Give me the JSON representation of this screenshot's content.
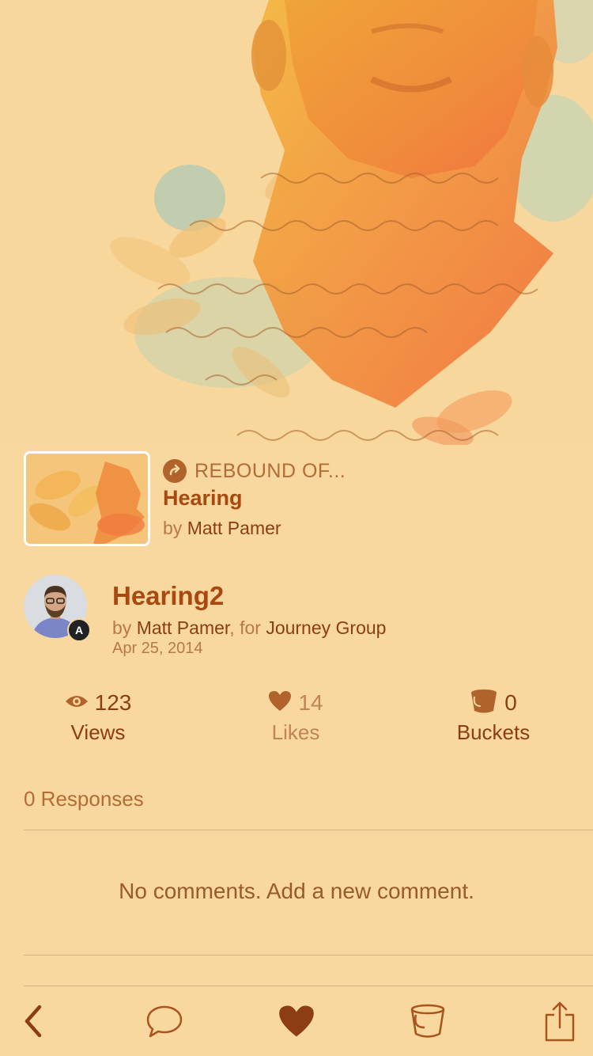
{
  "rebound": {
    "label": "REBOUND OF...",
    "title": "Hearing",
    "by_prefix": "by",
    "author": "Matt Pamer"
  },
  "shot": {
    "title": "Hearing2",
    "by_prefix": "by",
    "author": "Matt Pamer",
    "for_prefix": ", for",
    "team": "Journey Group",
    "date": "Apr 25, 2014",
    "badge": "A"
  },
  "stats": {
    "views": {
      "count": "123",
      "label": "Views"
    },
    "likes": {
      "count": "14",
      "label": "Likes"
    },
    "buckets": {
      "count": "0",
      "label": "Buckets"
    }
  },
  "responses_label": "0 Responses",
  "empty_comments": "No comments. Add a new comment.",
  "toolbar": {
    "icons": [
      "back-icon",
      "comment-icon",
      "heart-icon",
      "bucket-icon",
      "share-icon"
    ]
  },
  "colors": {
    "background": "#f8d89f",
    "accent": "#a9480f",
    "text_muted": "#b36c37"
  }
}
